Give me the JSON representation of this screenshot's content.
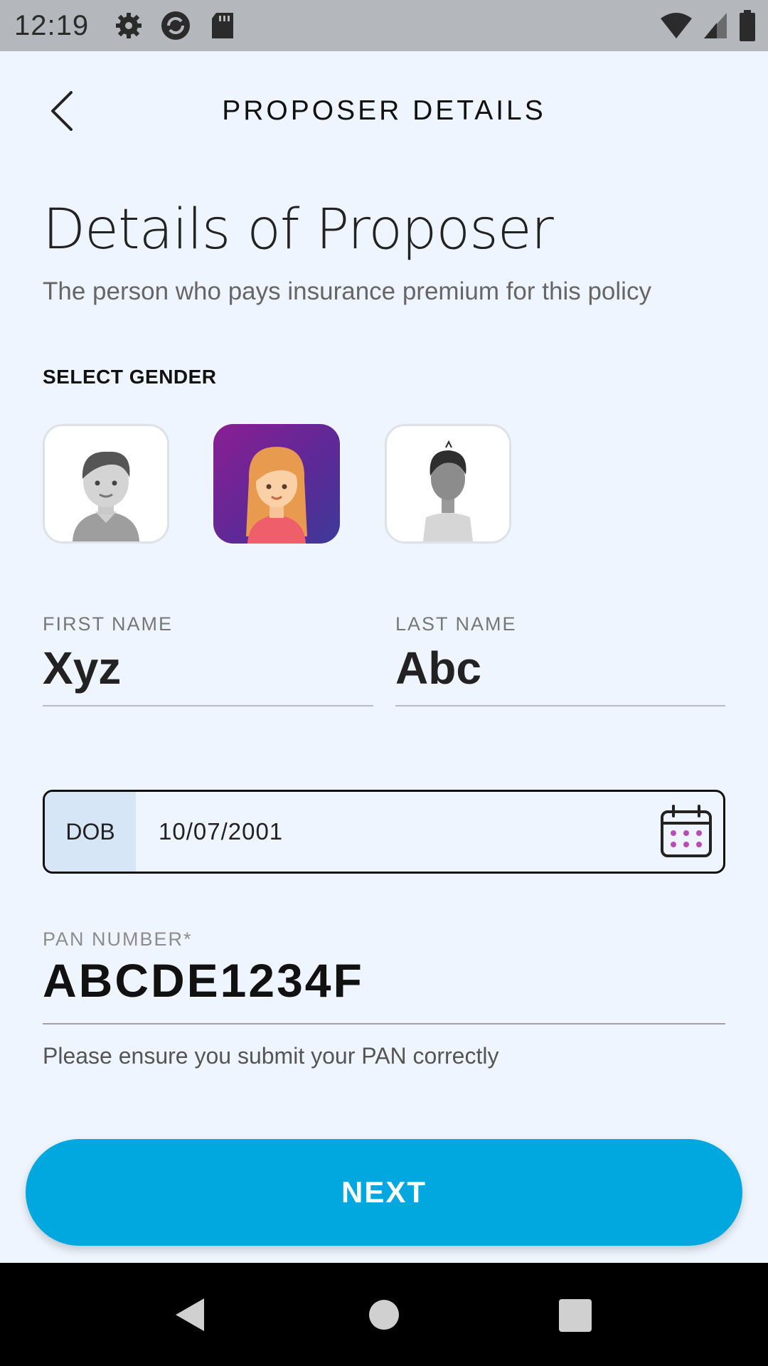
{
  "status_bar": {
    "time": "12:19",
    "left_icons": [
      "gear-icon",
      "sync-icon",
      "sd-card-icon"
    ],
    "right_icons": [
      "wifi-icon",
      "signal-icon",
      "battery-icon"
    ]
  },
  "header": {
    "title": "PROPOSER DETAILS",
    "back_icon": "chevron-left-icon"
  },
  "page": {
    "title": "Details of Proposer",
    "subtitle": "The person who pays insurance premium for this policy"
  },
  "gender": {
    "label": "SELECT GENDER",
    "options": [
      {
        "name": "male",
        "selected": false
      },
      {
        "name": "female",
        "selected": true
      },
      {
        "name": "other",
        "selected": false
      }
    ]
  },
  "first_name": {
    "label": "FIRST NAME",
    "value": "Xyz"
  },
  "last_name": {
    "label": "LAST NAME",
    "value": "Abc"
  },
  "dob": {
    "tag": "DOB",
    "value": "10/07/2001",
    "icon": "calendar-icon"
  },
  "pan": {
    "label": "PAN NUMBER*",
    "value": "ABCDE1234F",
    "helper": "Please ensure you submit your PAN correctly"
  },
  "next_button": {
    "label": "NEXT"
  },
  "colors": {
    "background": "#eef5fe",
    "accent": "#00a8df",
    "selected_gradient_start": "#8a1e93",
    "selected_gradient_end": "#3e3a9a"
  }
}
